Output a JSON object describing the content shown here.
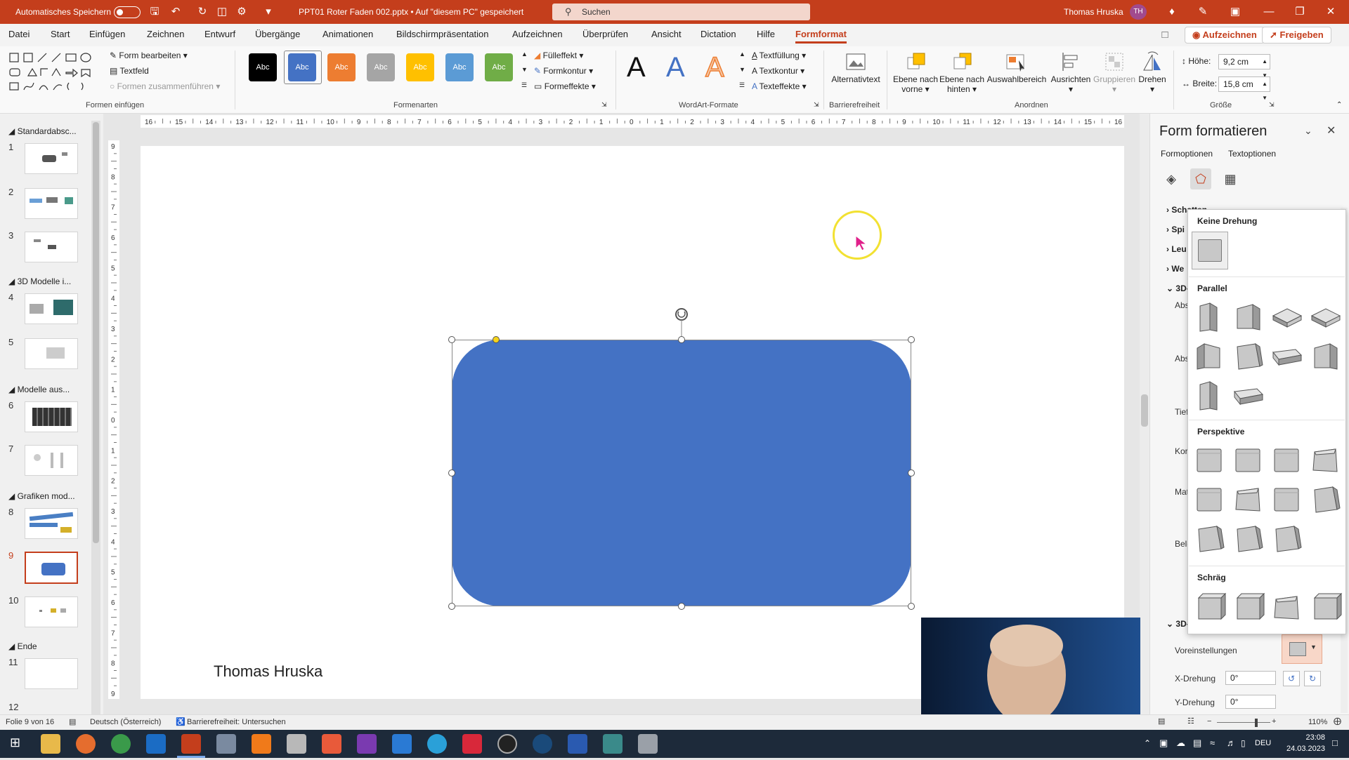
{
  "titlebar": {
    "autosave_label": "Automatisches Speichern",
    "file_title": "PPT01 Roter Faden 002.pptx • Auf \"diesem PC\" gespeichert",
    "search_placeholder": "Suchen",
    "user_name": "Thomas Hruska",
    "user_initials": "TH"
  },
  "menu": {
    "tabs": [
      "Datei",
      "Start",
      "Einfügen",
      "Zeichnen",
      "Entwurf",
      "Übergänge",
      "Animationen",
      "Bildschirmpräsentation",
      "Aufzeichnen",
      "Überprüfen",
      "Ansicht",
      "Dictation",
      "Hilfe",
      "Formformat"
    ],
    "record_button": "Aufzeichnen",
    "share_button": "Freigeben"
  },
  "ribbon": {
    "formen_einfuegen": {
      "label": "Formen einfügen",
      "form_bearbeiten": "Form bearbeiten",
      "textfeld": "Textfeld",
      "formen_zusammenfuehren": "Formen zusammenführen"
    },
    "formenarten": {
      "label": "Formenarten",
      "style_text": "Abc",
      "styles": [
        "#000000",
        "#4472c4",
        "#ed7d31",
        "#a5a5a5",
        "#ffc000",
        "#5b9bd5",
        "#70ad47"
      ],
      "fuelleffekt": "Fülleffekt",
      "formkontur": "Formkontur",
      "formeffekte": "Formeffekte"
    },
    "wordart": {
      "label": "WordArt-Formate",
      "letter": "A",
      "textfuellung": "Textfüllung",
      "textkontur": "Textkontur",
      "texteffekte": "Texteffekte"
    },
    "barrierefreiheit": {
      "label": "Barrierefreiheit",
      "alternativtext": "Alternativtext"
    },
    "anordnen": {
      "label": "Anordnen",
      "ebene_vorne_1": "Ebene nach",
      "ebene_vorne_2": "vorne",
      "ebene_hinten_1": "Ebene nach",
      "ebene_hinten_2": "hinten",
      "auswahlbereich": "Auswahlbereich",
      "ausrichten": "Ausrichten",
      "gruppieren": "Gruppieren",
      "drehen": "Drehen"
    },
    "groesse": {
      "label": "Größe",
      "hoehe_label": "Höhe:",
      "hoehe_value": "9,2 cm",
      "breite_label": "Breite:",
      "breite_value": "15,8 cm"
    }
  },
  "slides_panel": {
    "sections": [
      "Standardabsc...",
      "3D Modelle i...",
      "Modelle aus...",
      "Grafiken mod...",
      "Ende"
    ],
    "slide_numbers": [
      "1",
      "2",
      "3",
      "4",
      "5",
      "6",
      "7",
      "8",
      "9",
      "10",
      "11",
      "12"
    ],
    "selected_slide": 9
  },
  "slide": {
    "author": "Thomas Hruska",
    "shape_color": "#4472c4"
  },
  "ruler": {
    "h_ticks": [
      "16",
      "15",
      "14",
      "13",
      "12",
      "11",
      "10",
      "9",
      "8",
      "7",
      "6",
      "5",
      "4",
      "3",
      "2",
      "1",
      "0",
      "1",
      "2",
      "3",
      "4",
      "5",
      "6",
      "7",
      "8",
      "9",
      "10",
      "11",
      "12",
      "13",
      "14",
      "15",
      "16"
    ],
    "v_ticks": [
      "9",
      "8",
      "7",
      "6",
      "5",
      "4",
      "3",
      "2",
      "1",
      "0",
      "1",
      "2",
      "3",
      "4",
      "5",
      "6",
      "7",
      "8",
      "9"
    ]
  },
  "format_pane": {
    "title": "Form formatieren",
    "tab_form": "Formoptionen",
    "tab_text": "Textoptionen",
    "sections": [
      "Schatten",
      "Spi",
      "Leu",
      "We",
      "3D-"
    ],
    "labels_partial": [
      "Abs",
      "Abs",
      "Tief",
      "Kor",
      "Mat",
      "Bele"
    ],
    "section_3d_rotation": "3D-",
    "voreinstellungen": "Voreinstellungen",
    "x_drehung_label": "X-Drehung",
    "x_drehung_value": "0°",
    "y_drehung_label": "Y-Drehung",
    "y_drehung_value": "0°"
  },
  "rotation_dropdown": {
    "keine_drehung": "Keine Drehung",
    "parallel": "Parallel",
    "perspektive": "Perspektive",
    "schraeg": "Schräg"
  },
  "statusbar": {
    "slide_info": "Folie 9 von 16",
    "language": "Deutsch (Österreich)",
    "accessibility": "Barrierefreiheit: Untersuchen",
    "zoom": "110%"
  },
  "taskbar": {
    "language": "DEU",
    "time": "23:08",
    "date": "24.03.2023"
  }
}
